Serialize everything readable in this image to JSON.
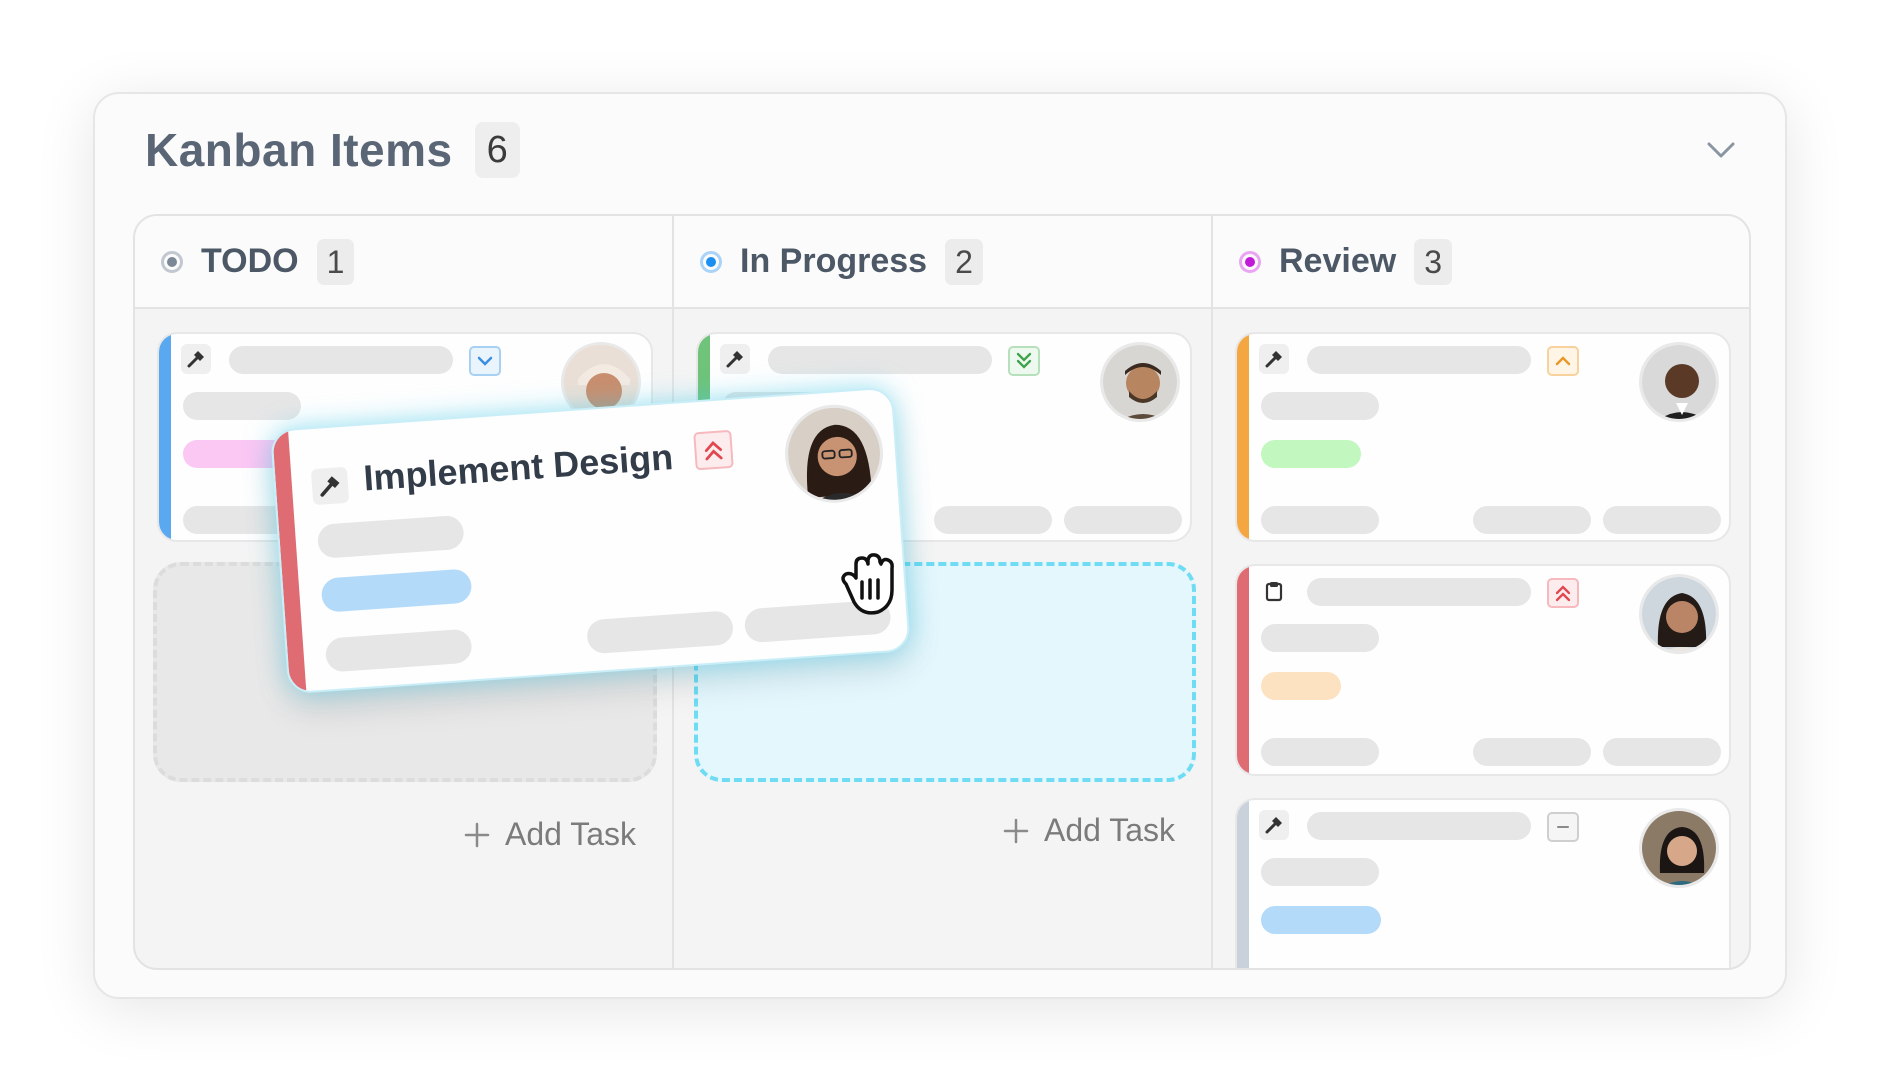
{
  "header": {
    "title": "Kanban Items",
    "count": "6"
  },
  "columns": [
    {
      "name": "TODO",
      "count": "1",
      "color": "#7c8896"
    },
    {
      "name": "In Progress",
      "count": "2",
      "color": "#1a8ff0"
    },
    {
      "name": "Review",
      "count": "3",
      "color": "#c11ad9"
    }
  ],
  "add_task_label": "Add Task",
  "dragging_card": {
    "title": "Implement Design",
    "priority": "urgent",
    "icon": "hammer-icon"
  },
  "colors": {
    "todo_card_accent": "#5aa8f0",
    "progress_card_accent": "#6fc37a",
    "review_card1_accent": "#f4a640",
    "review_card2_accent": "#e06c73",
    "review_card3_accent": "#c9d2db",
    "drag_glow": "#48d0f0"
  }
}
